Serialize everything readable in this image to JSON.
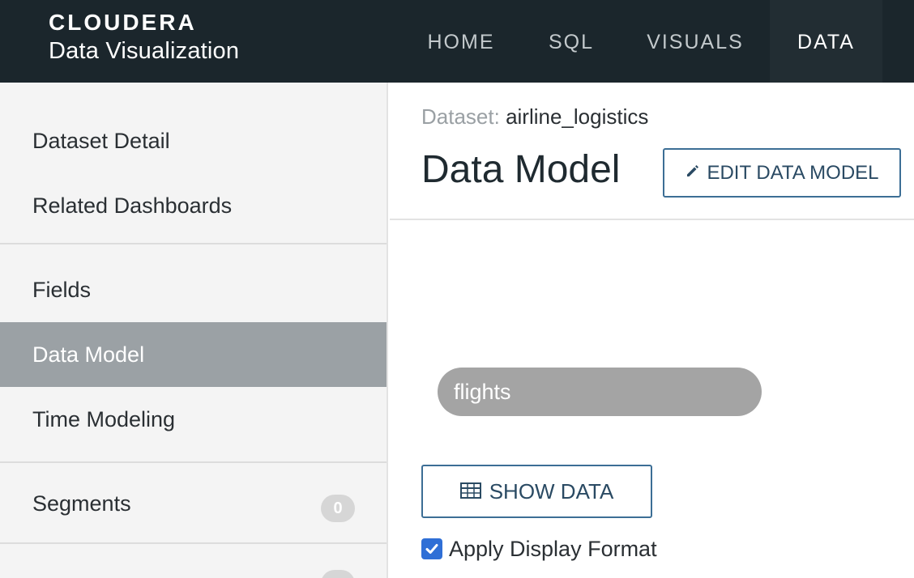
{
  "brand": {
    "logo_text": "CLOUDERA",
    "product": "Data Visualization"
  },
  "nav": {
    "items": [
      {
        "label": "HOME"
      },
      {
        "label": "SQL"
      },
      {
        "label": "VISUALS"
      },
      {
        "label": "DATA"
      }
    ],
    "active": "DATA"
  },
  "sidebar": {
    "groups": [
      {
        "items": [
          {
            "label": "Dataset Detail"
          },
          {
            "label": "Related Dashboards"
          }
        ]
      },
      {
        "items": [
          {
            "label": "Fields"
          },
          {
            "label": "Data Model"
          },
          {
            "label": "Time Modeling"
          }
        ]
      },
      {
        "items": [
          {
            "label": "Segments",
            "badge": "0"
          }
        ]
      }
    ],
    "active": "Data Model"
  },
  "main": {
    "breadcrumb_label": "Dataset:",
    "breadcrumb_value": "airline_logistics",
    "title": "Data Model",
    "edit_button": "EDIT DATA MODEL",
    "table_name": "flights",
    "show_data_button": "SHOW DATA",
    "apply_display_format": {
      "label": "Apply Display Format",
      "checked": true
    }
  },
  "colors": {
    "navbar": "#1b262c",
    "nav_active_underline": "#5a9fd8",
    "sidebar_active": "#9ba1a5",
    "button_border": "#3c6e95",
    "table_pill": "#a4a4a4",
    "checkbox": "#2f6fd6"
  },
  "icons": {
    "edit_button": "pencil-icon",
    "show_data_button": "table-grid-icon",
    "checkbox": "checkmark-icon"
  }
}
